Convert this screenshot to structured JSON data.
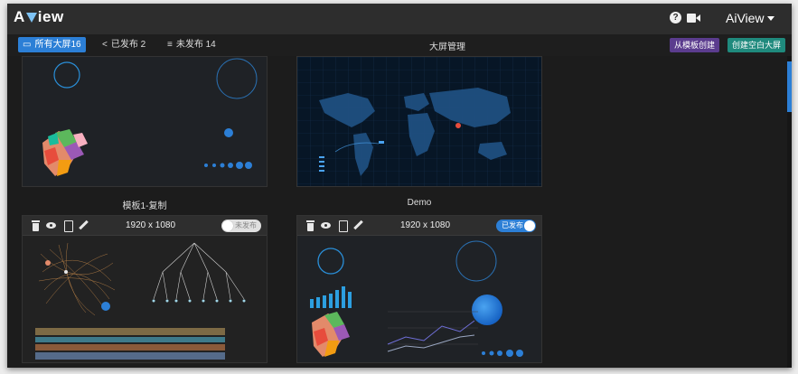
{
  "app": {
    "logo_prefix": "A",
    "logo_suffix": "iew",
    "user": "AiView"
  },
  "tabs": [
    {
      "label": "所有大屏16",
      "icon": "monitor-icon",
      "active": true
    },
    {
      "label": "已发布 2",
      "icon": "share-icon",
      "active": false
    },
    {
      "label": "未发布 14",
      "icon": "list-icon",
      "active": false
    }
  ],
  "page_title": "大屏管理",
  "actions": {
    "from_template": "从模板创建",
    "create_blank": "创建空白大屏"
  },
  "cards": [
    {
      "name": "模板1-复制"
    },
    {
      "name": "Demo"
    },
    {
      "resolution": "1920 x 1080",
      "status": "未发布",
      "published": false
    },
    {
      "resolution": "1920 x 1080",
      "status": "已发布",
      "published": true
    }
  ],
  "colors": {
    "accent": "#2c7fd6",
    "purple": "#5b3c8e",
    "teal": "#1f8a7d"
  }
}
